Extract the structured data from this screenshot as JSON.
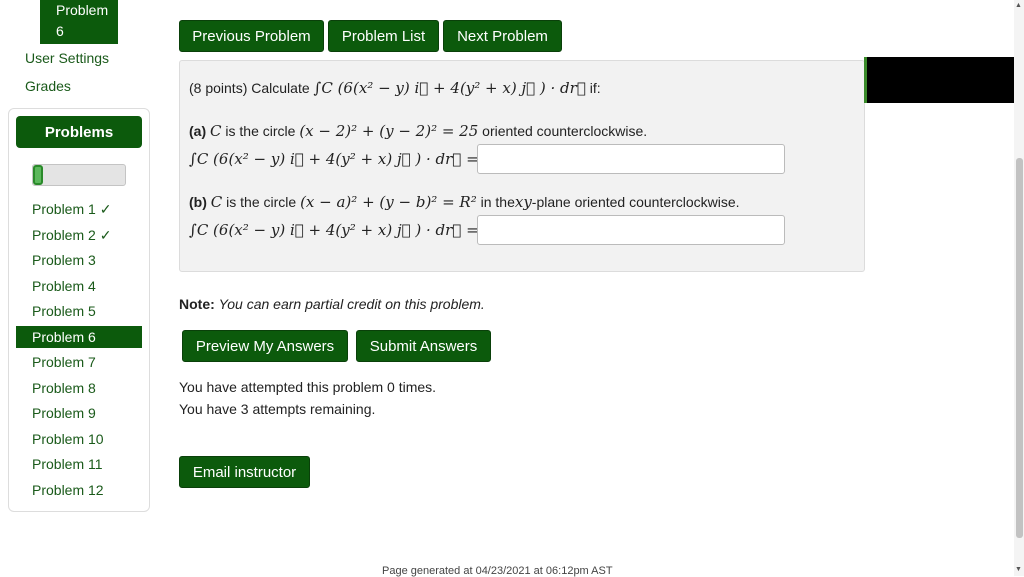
{
  "sidebar": {
    "current_problem_label_1": "Problem",
    "current_problem_label_2": "6",
    "user_settings": "User Settings",
    "grades": "Grades",
    "problems_button": "Problems",
    "progress_fraction": 0.11,
    "problems": [
      "Problem 1 ✓",
      "Problem 2 ✓",
      "Problem 3",
      "Problem 4",
      "Problem 5",
      "Problem 6",
      "Problem 7",
      "Problem 8",
      "Problem 9",
      "Problem 10",
      "Problem 11",
      "Problem 12"
    ]
  },
  "nav": {
    "previous": "Previous Problem",
    "list": "Problem List",
    "next": "Next Problem"
  },
  "problem": {
    "intro_prefix": "(8 points) Calculate",
    "intro_math": "∫C (6(x² − y) i⃗ + 4(y² + x) j⃗ ) · dr⃗",
    "intro_suffix": "if:",
    "a_label": "(a)",
    "a_text_1": "is the circle",
    "a_math_circle": "(x − 2)² + (y − 2)² = 25",
    "a_text_2": "oriented counterclockwise.",
    "a_integral": "∫C (6(x² − y) i⃗ + 4(y² + x) j⃗ ) · dr⃗ =",
    "b_label": "(b)",
    "b_text_1": "is the circle",
    "b_math_circle": "(x − a)² + (y − b)² = R²",
    "b_text_2": "in the",
    "b_math_plane": "xy",
    "b_text_3": "-plane oriented counterclockwise.",
    "b_integral": "∫C (6(x² − y) i⃗ + 4(y² + x) j⃗ ) · dr⃗ =",
    "c_symbol": "C"
  },
  "note": {
    "label": "Note:",
    "text": "You can earn partial credit on this problem."
  },
  "actions": {
    "preview": "Preview My Answers",
    "submit": "Submit Answers",
    "email": "Email instructor"
  },
  "status": {
    "attempted": "You have attempted this problem 0 times.",
    "remaining": "You have 3 attempts remaining."
  },
  "footer": {
    "generated": "Page generated at 04/23/2021 at 06:12pm AST"
  },
  "colors": {
    "brand_green": "#0c5a0c",
    "progress_green": "#5cb85c"
  }
}
